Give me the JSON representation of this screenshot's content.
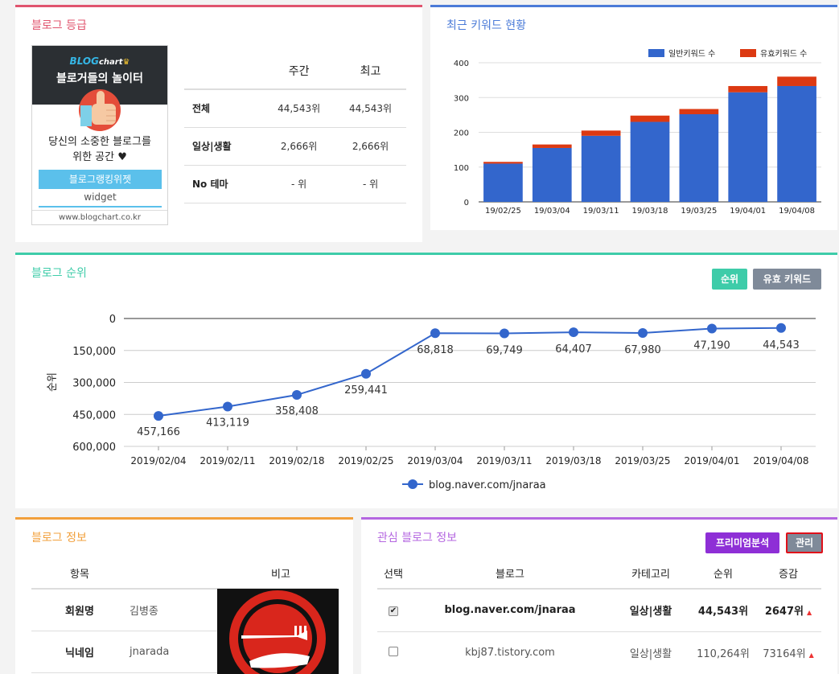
{
  "grade": {
    "title": "블로그 등급",
    "widget": {
      "logo_blog": "BLOG",
      "logo_chart": "chart",
      "subtitle": "블로거들의 놀이터",
      "text_line1": "당신의 소중한 블로그를",
      "text_line2": "위한 공간 ♥",
      "button": "블로그랭킹위젯",
      "widget_label": "widget",
      "url": "www.blogchart.co.kr"
    },
    "headers": [
      "",
      "주간",
      "최고"
    ],
    "rows": [
      {
        "label": "전체",
        "weekly": "44,543위",
        "best": "44,543위"
      },
      {
        "label": "일상|생활",
        "weekly": "2,666위",
        "best": "2,666위"
      },
      {
        "label": "No 테마",
        "weekly": "- 위",
        "best": "- 위"
      }
    ]
  },
  "keyword": {
    "title": "최근 키워드 현황",
    "colors": {
      "general": "#3366cc",
      "effective": "#dc3912"
    },
    "chart_data": {
      "type": "bar",
      "stacked": true,
      "categories": [
        "19/02/25",
        "19/03/04",
        "19/03/11",
        "19/03/18",
        "19/03/25",
        "19/04/01",
        "19/04/08"
      ],
      "series": [
        {
          "name": "일반키워드 수",
          "values": [
            110,
            155,
            190,
            230,
            252,
            315,
            333
          ]
        },
        {
          "name": "유효키워드 수",
          "values": [
            5,
            10,
            15,
            18,
            15,
            18,
            27
          ]
        }
      ],
      "ylim": [
        0,
        400
      ],
      "yticks": [
        0,
        100,
        200,
        300,
        400
      ],
      "legend": "top-right",
      "grid": true
    }
  },
  "rank": {
    "title": "블로그 순위",
    "btn_rank": "순위",
    "btn_keyword": "유효 키워드",
    "colors": {
      "line": "#3366cc",
      "btn_rank": "#3ecca9",
      "btn_keyword": "#7f8a99"
    },
    "chart_data": {
      "type": "line",
      "categories": [
        "2019/02/04",
        "2019/02/11",
        "2019/02/18",
        "2019/02/25",
        "2019/03/04",
        "2019/03/11",
        "2019/03/18",
        "2019/03/25",
        "2019/04/01",
        "2019/04/08"
      ],
      "series": [
        {
          "name": "blog.naver.com/jnaraa",
          "values": [
            457166,
            413119,
            358408,
            259441,
            68818,
            69749,
            64407,
            67980,
            47190,
            44543
          ]
        }
      ],
      "labels": [
        "457,166",
        "413,119",
        "358,408",
        "259,441",
        "68,818",
        "69,749",
        "64,407",
        "67,980",
        "47,190",
        "44,543"
      ],
      "ylabel": "순위",
      "ylim": [
        0,
        600000
      ],
      "yticks": [
        "0",
        "150,000",
        "300,000",
        "450,000",
        "600,000"
      ],
      "y_inverted": true,
      "legend": "bottom",
      "grid": true
    }
  },
  "info": {
    "title": "블로그 정보",
    "headers": [
      "항목",
      "비고"
    ],
    "rows": [
      {
        "label": "회원명",
        "value": "김병종"
      },
      {
        "label": "닉네임",
        "value": "jnarada"
      }
    ]
  },
  "interest": {
    "title": "관심 블로그 정보",
    "btn_premium": "프리미엄분석",
    "btn_manage": "관리",
    "headers": [
      "선택",
      "블로그",
      "카테고리",
      "순위",
      "증감"
    ],
    "rows": [
      {
        "checked": "✔",
        "blog": "blog.naver.com/jnaraa",
        "category": "일상|생활",
        "rank": "44,543위",
        "change": "2647위"
      },
      {
        "checked": "",
        "blog": "kbj87.tistory.com",
        "category": "일상|생활",
        "rank": "110,264위",
        "change": "73164위"
      }
    ]
  }
}
